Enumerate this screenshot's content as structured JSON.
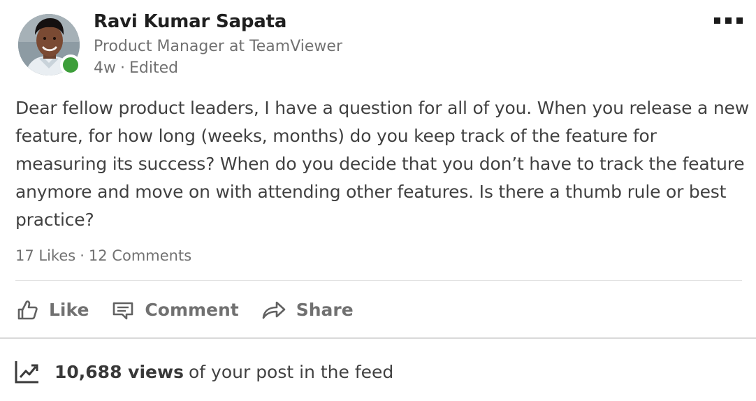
{
  "author": {
    "name": "Ravi Kumar Sapata",
    "headline": "Product Manager at TeamViewer",
    "time": "4w",
    "edited": "Edited",
    "presence_color": "#3d9e3a"
  },
  "post": {
    "text": "Dear fellow product leaders, I have a question for all of you. When you release a new feature, for how long (weeks, months) do you keep track of the feature for measuring its success? When do you decide that you don’t have to track the feature anymore and move on with attending other features. Is there a thumb rule or best practice?"
  },
  "social": {
    "likes": "17 Likes",
    "comments": "12 Comments",
    "separator": "·"
  },
  "actions": {
    "like": "Like",
    "comment": "Comment",
    "share": "Share"
  },
  "analytics": {
    "views_count": "10,688 views",
    "views_suffix": "of your post in the feed"
  },
  "icons": {
    "more": "ellipsis-icon",
    "like": "thumbs-up-icon",
    "comment": "speech-bubble-icon",
    "share": "share-arrow-icon",
    "views": "trending-chart-icon"
  }
}
